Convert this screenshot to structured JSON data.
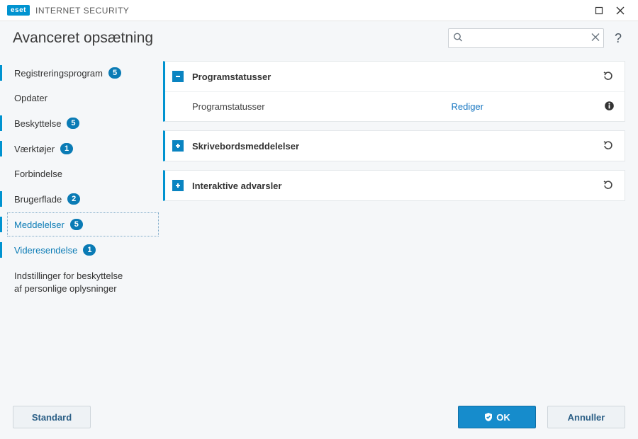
{
  "titleBar": {
    "brand": "eset",
    "product": "INTERNET SECURITY"
  },
  "header": {
    "title": "Avanceret opsætning",
    "search_placeholder": "",
    "help_label": "?"
  },
  "sidebar": {
    "items": [
      {
        "label": "Registreringsprogram",
        "badge": "5",
        "accent": true
      },
      {
        "label": "Opdater"
      },
      {
        "label": "Beskyttelse",
        "badge": "5",
        "accent": true
      },
      {
        "label": "Værktøjer",
        "badge": "1",
        "accent": true
      },
      {
        "label": "Forbindelse"
      },
      {
        "label": "Brugerflade",
        "badge": "2",
        "accent": true
      },
      {
        "label": "Meddelelser",
        "badge": "5",
        "accent": true,
        "active": true,
        "focus": true
      },
      {
        "label": "Videresendelse",
        "badge": "1",
        "accent": true,
        "active": true,
        "sub": true
      }
    ],
    "privacy_line1": "Indstillinger for beskyttelse",
    "privacy_line2": "af personlige oplysninger"
  },
  "panels": [
    {
      "title": "Programstatusser",
      "expanded": true,
      "rows": [
        {
          "label": "Programstatusser",
          "action": "Rediger",
          "info": true
        }
      ]
    },
    {
      "title": "Skrivebordsmeddelelser",
      "expanded": false
    },
    {
      "title": "Interaktive advarsler",
      "expanded": false
    }
  ],
  "footer": {
    "default": "Standard",
    "ok": "OK",
    "cancel": "Annuller"
  }
}
